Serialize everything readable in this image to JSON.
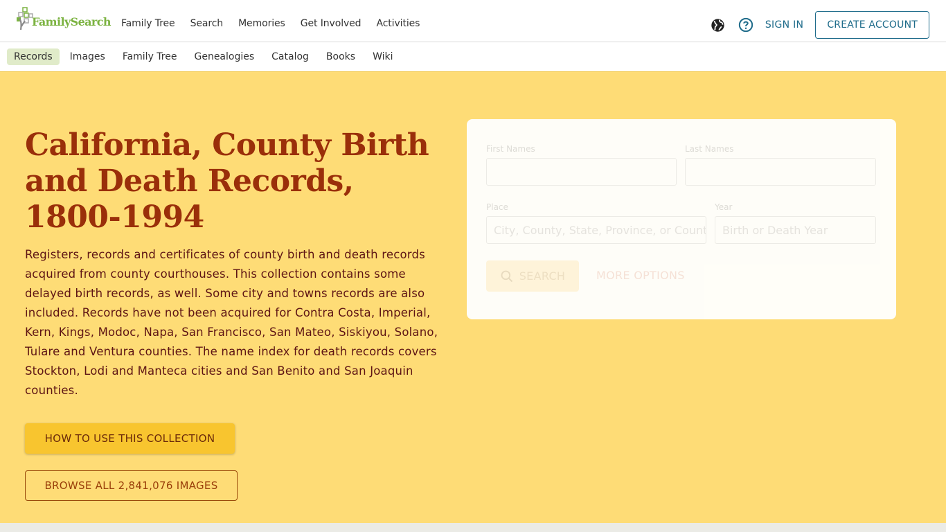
{
  "header": {
    "logo_text": "FamilySearch",
    "main_nav": [
      "Family Tree",
      "Search",
      "Memories",
      "Get Involved",
      "Activities"
    ],
    "language_icon": "globe-icon",
    "help_icon": "question-circle-icon",
    "sign_in": "SIGN IN",
    "create_account": "CREATE ACCOUNT"
  },
  "subnav": {
    "items": [
      "Records",
      "Images",
      "Family Tree",
      "Genealogies",
      "Catalog",
      "Books",
      "Wiki"
    ],
    "active": "Records"
  },
  "collection": {
    "title": "California, County Birth and Death Records, 1800-1994",
    "description": "Registers, records and certificates of county birth and death records acquired from county courthouses. This collection contains some delayed birth records, as well. Some city and towns records are also included. Records have not been acquired for Contra Costa, Imperial, Kern, Kings, Modoc, Napa, San Francisco, San Mateo, Siskiyou, Solano, Tulare and Ventura counties. The name index for death records covers Stockton, Lodi and Manteca cities and San Benito and San Joaquin counties.",
    "how_to_use": "HOW TO USE THIS COLLECTION",
    "browse_all": "BROWSE ALL 2,841,076 IMAGES"
  },
  "search_form": {
    "first_names_label": "First Names",
    "first_names_value": "",
    "last_names_label": "Last Names",
    "last_names_value": "",
    "place_label": "Place",
    "place_placeholder": "City, County, State, Province, or Country",
    "year_label": "Year",
    "year_placeholder": "Birth or Death Year",
    "search_button": "SEARCH",
    "more_options": "MORE OPTIONS"
  },
  "colors": {
    "hero_bg": "#fedc76",
    "title": "#9a2f0a",
    "brand_green": "#7cb342",
    "link_teal": "#1e6b8a",
    "primary_button": "#f8c52f"
  }
}
